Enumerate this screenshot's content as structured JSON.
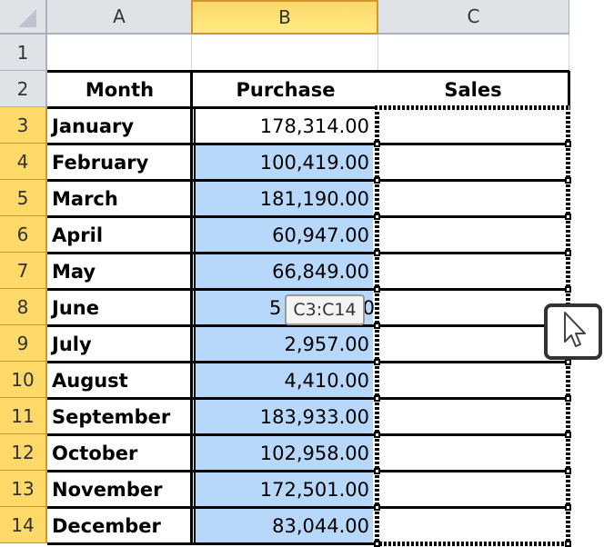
{
  "columns": [
    "A",
    "B",
    "C"
  ],
  "selected_column": "B",
  "row_numbers": [
    "1",
    "2",
    "3",
    "4",
    "5",
    "6",
    "7",
    "8",
    "9",
    "10",
    "11",
    "12",
    "13",
    "14"
  ],
  "headers": {
    "month": "Month",
    "purchase": "Purchase",
    "sales": "Sales"
  },
  "rows": [
    {
      "month": "January",
      "purchase": "178,314.00"
    },
    {
      "month": "February",
      "purchase": "100,419.00"
    },
    {
      "month": "March",
      "purchase": "181,190.00"
    },
    {
      "month": "April",
      "purchase": "60,947.00"
    },
    {
      "month": "May",
      "purchase": "66,849.00"
    },
    {
      "month": "June",
      "purchase": "5"
    },
    {
      "month": "July",
      "purchase": "2,957.00"
    },
    {
      "month": "August",
      "purchase": "4,410.00"
    },
    {
      "month": "September",
      "purchase": "183,933.00"
    },
    {
      "month": "October",
      "purchase": "102,958.00"
    },
    {
      "month": "November",
      "purchase": "172,501.00"
    },
    {
      "month": "December",
      "purchase": "83,044.00"
    }
  ],
  "june_purchase_tail": "0",
  "range_tooltip": "C3:C14",
  "colors": {
    "selection_fill": "#b7d8fb",
    "header_selected": "#fdd96a"
  }
}
